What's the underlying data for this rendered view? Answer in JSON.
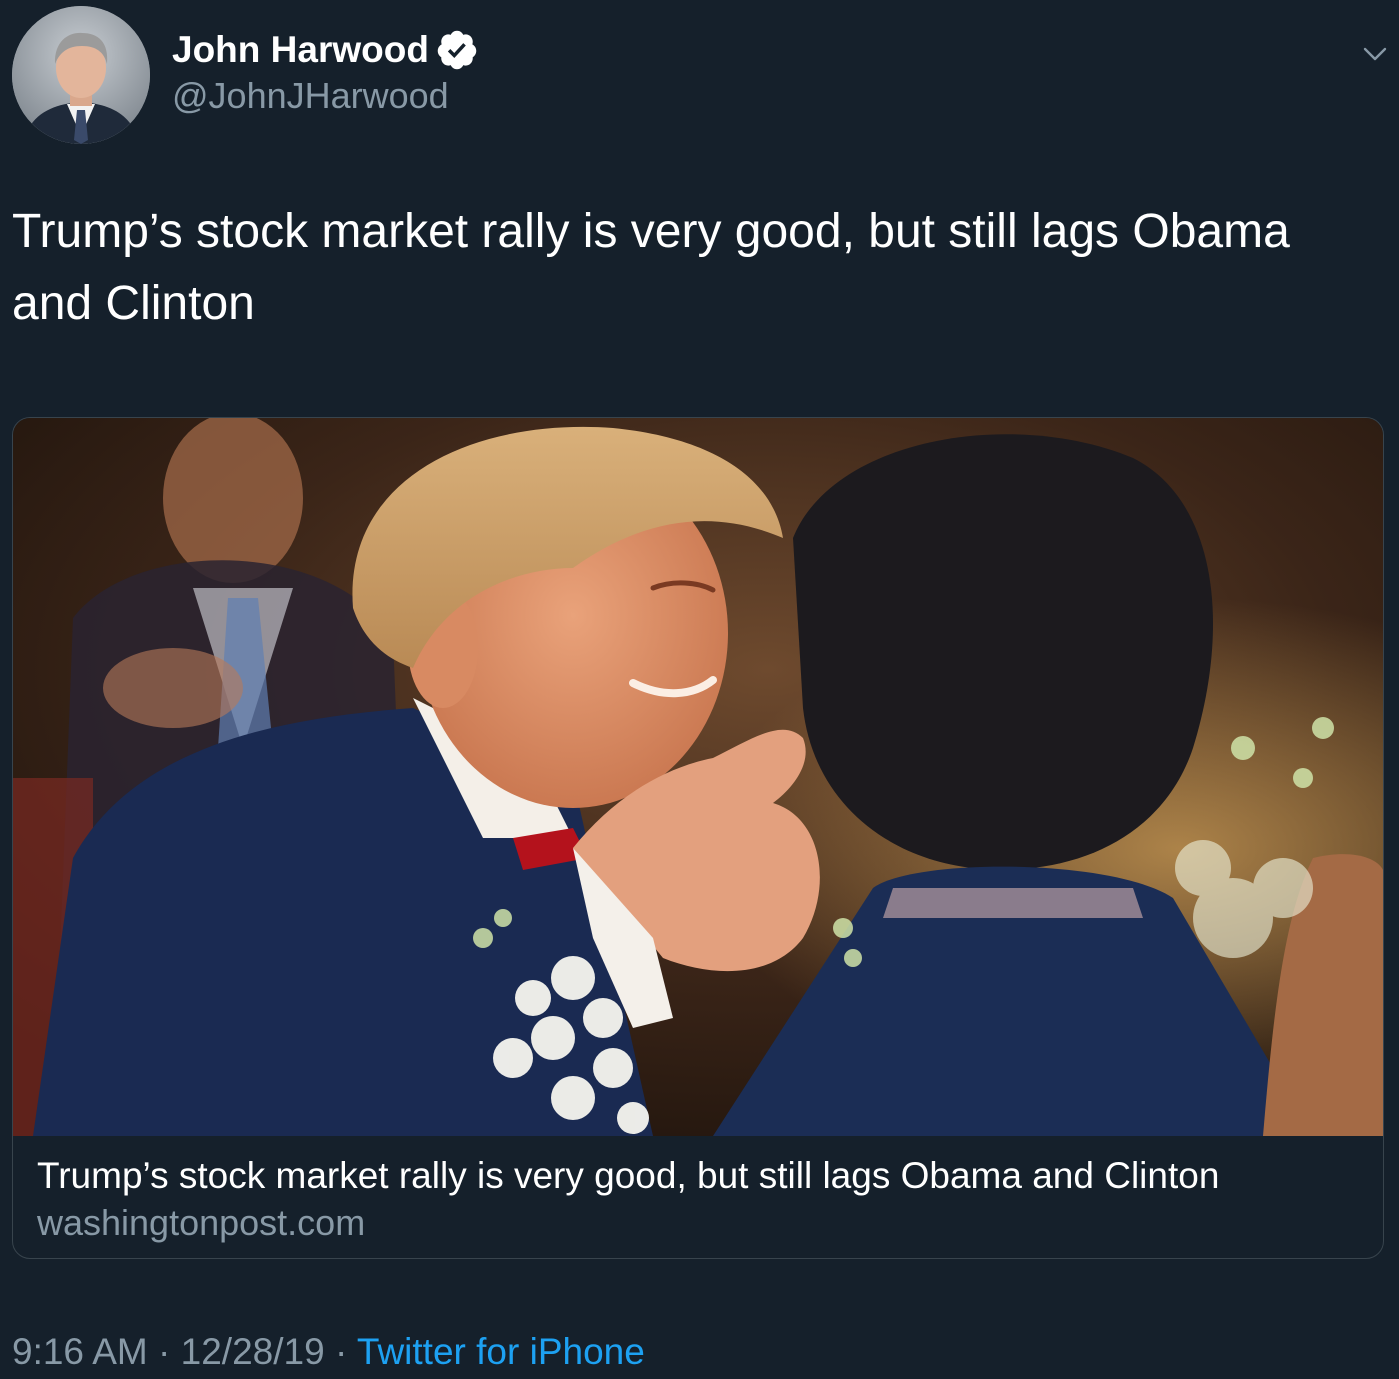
{
  "author": {
    "display_name": "John Harwood",
    "handle": "@JohnJHarwood",
    "verified": true,
    "avatar_icon": "profile-photo"
  },
  "tweet": {
    "text": "Trump’s stock market rally is very good, but still lags Obama and Clinton"
  },
  "link_card": {
    "image_icon": "article-photo",
    "title": "Trump’s stock market rally is very good, but still lags Obama and Clinton",
    "domain": "washingtonpost.com"
  },
  "meta": {
    "time": "9:16 AM",
    "separator": " · ",
    "date": "12/28/19",
    "source": "Twitter for iPhone"
  },
  "colors": {
    "background": "#15202b",
    "secondary_text": "#8899a6",
    "link": "#1da1f2",
    "card_border": "#38444d"
  },
  "icons": {
    "verified": "verified-badge-icon",
    "more": "chevron-down-icon"
  }
}
